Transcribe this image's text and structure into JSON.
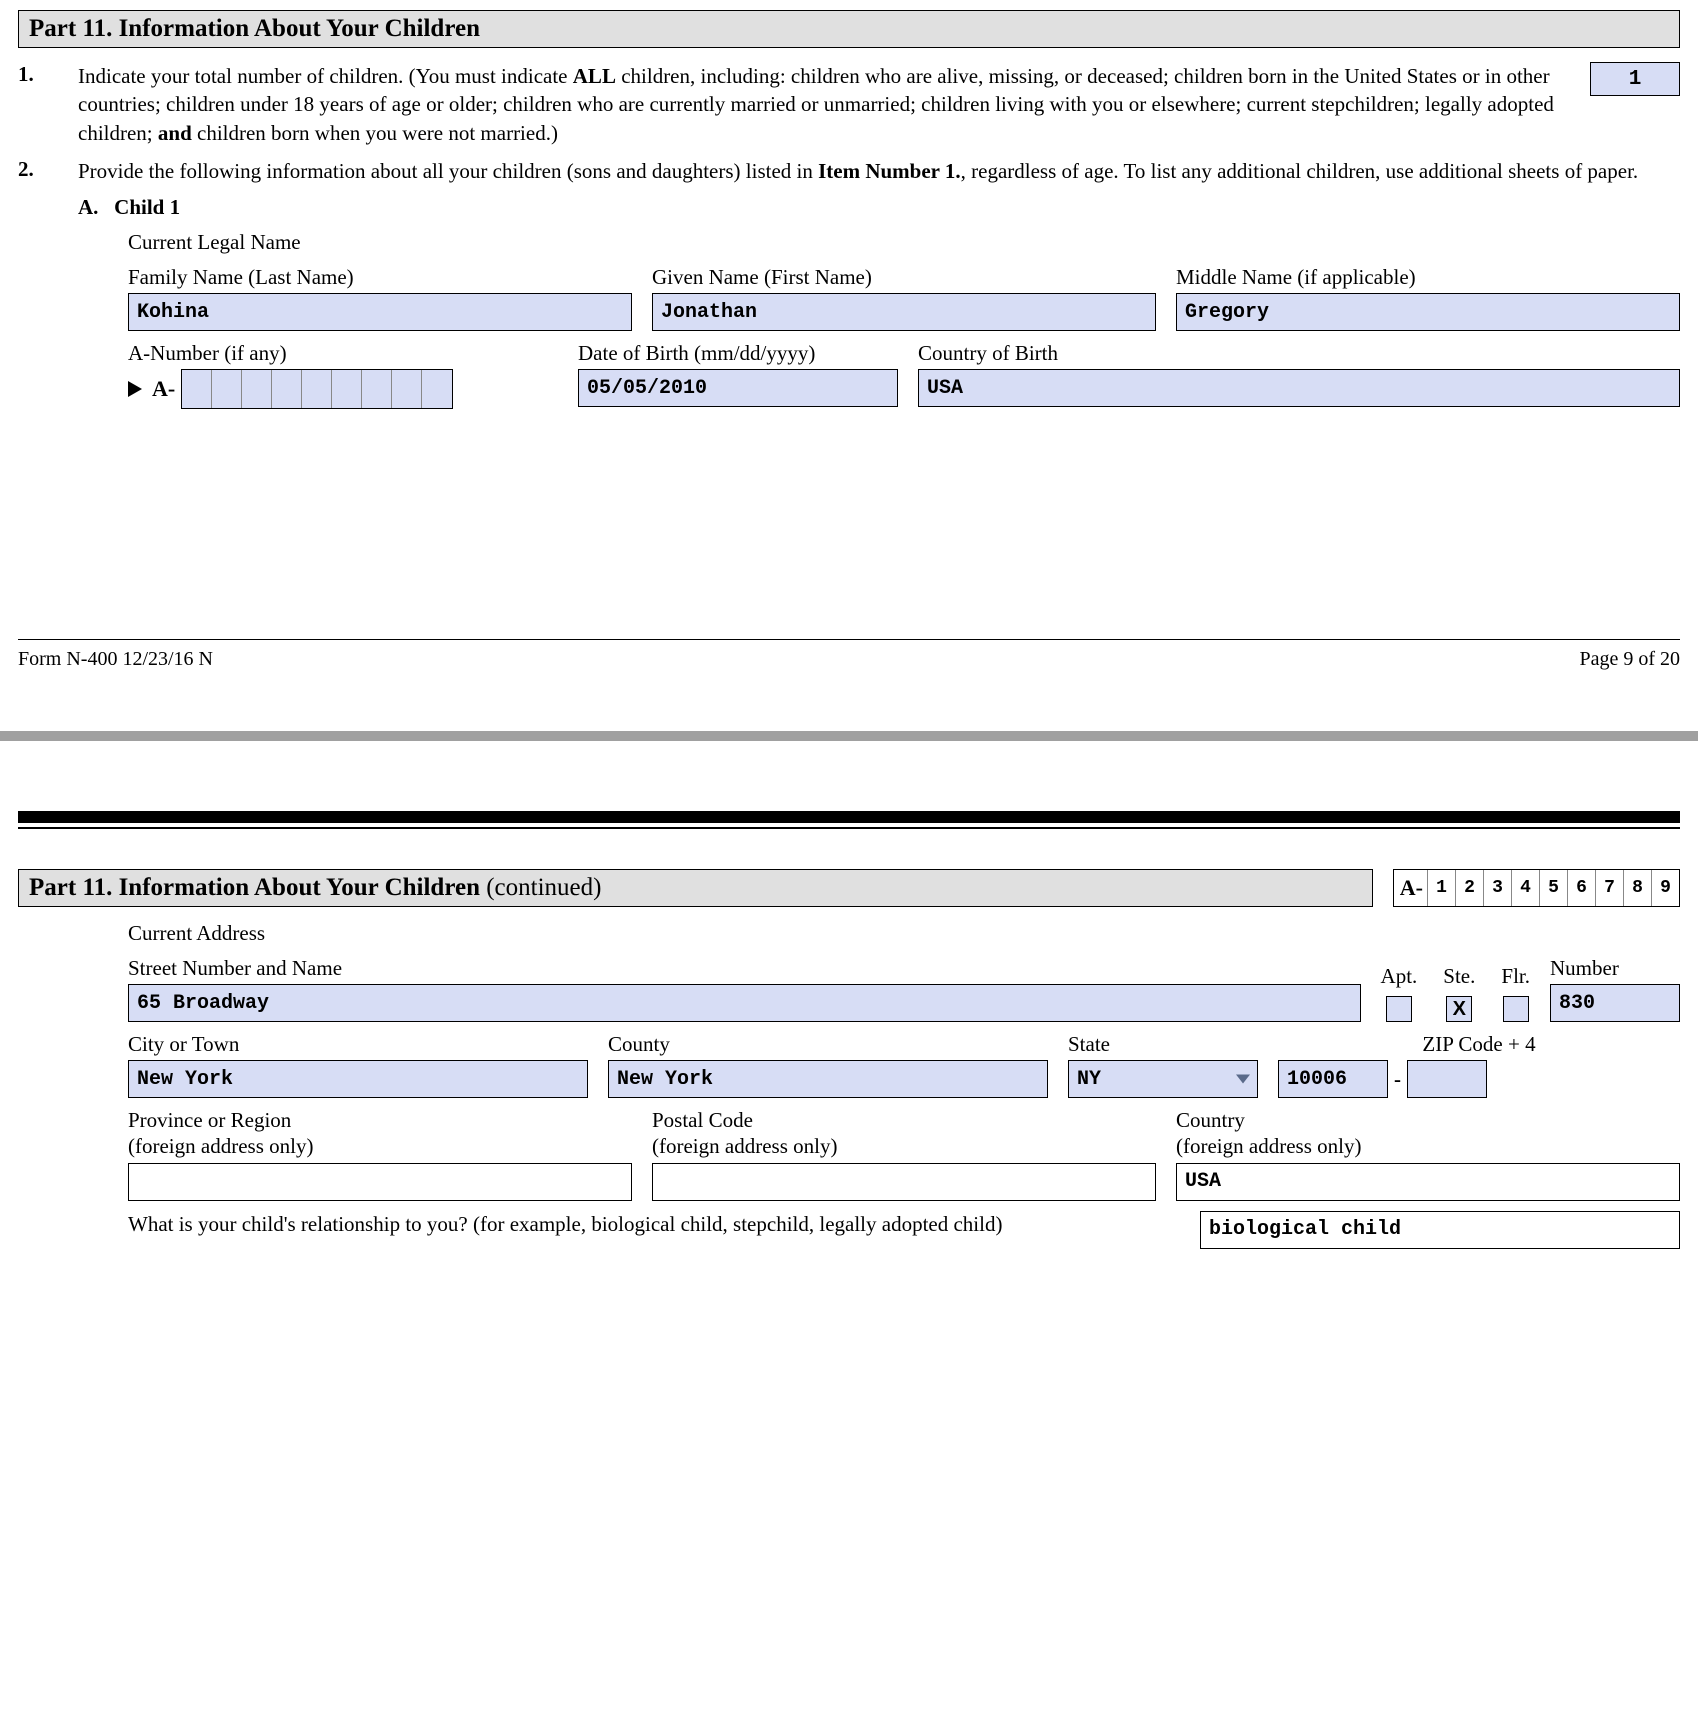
{
  "part": {
    "title_main": "Part 11.  Information About Your Children",
    "title_cont": " (continued)"
  },
  "q1": {
    "num": "1.",
    "text_pre": "Indicate your total number of children.  (You must indicate ",
    "text_all": "ALL",
    "text_mid": " children, including:  children who are alive, missing, or deceased; children born in the United States or in other countries; children under 18 years of age or older; children who are currently married or unmarried; children living with you or elsewhere; current stepchildren; legally adopted children; ",
    "text_and": "and",
    "text_post": " children born when you were not married.)",
    "total": "1"
  },
  "q2": {
    "num": "2.",
    "text_pre": "Provide the following information about all your children (sons and daughters) listed in ",
    "text_bold": "Item Number 1.",
    "text_post": ", regardless of age. To list any additional children, use additional sheets of paper."
  },
  "childA": {
    "letter": "A.",
    "heading": "Child 1",
    "legal_name_label": "Current Legal Name",
    "family_label": "Family Name (Last Name)",
    "family_val": "Kohina",
    "given_label": "Given Name (First Name)",
    "given_val": "Jonathan",
    "middle_label": "Middle Name (if applicable)",
    "middle_val": "Gregory",
    "anum_label": "A-Number (if any)",
    "anum_prefix": "A-",
    "dob_label": "Date of Birth (mm/dd/yyyy)",
    "dob_val": "05/05/2010",
    "cob_label": "Country of Birth",
    "cob_val": "USA"
  },
  "footer": {
    "form": "Form N-400   12/23/16   N",
    "page": "Page 9 of 20"
  },
  "a_header": {
    "prefix": "A-",
    "digits": [
      "1",
      "2",
      "3",
      "4",
      "5",
      "6",
      "7",
      "8",
      "9"
    ]
  },
  "address": {
    "heading": "Current Address",
    "street_label": "Street Number and Name",
    "street_val": "65 Broadway",
    "apt_label": "Apt.",
    "ste_label": "Ste.",
    "flr_label": "Flr.",
    "number_label": "Number",
    "apt_checked": "",
    "ste_checked": "X",
    "flr_checked": "",
    "number_val": "830",
    "city_label": "City or Town",
    "city_val": "New York",
    "county_label": "County",
    "county_val": "New York",
    "state_label": "State",
    "state_val": "NY",
    "zip_label": "ZIP Code + 4",
    "zip_val": "10006",
    "zip4_val": "",
    "province_label1": "Province or Region",
    "province_label2": "(foreign address only)",
    "province_val": "",
    "postal_label1": "Postal Code",
    "postal_label2": "(foreign address only)",
    "postal_val": "",
    "country_label1": "Country",
    "country_label2": "(foreign address only)",
    "country_val": "USA"
  },
  "relationship": {
    "question": "What is your child's relationship to you? (for example, biological child, stepchild, legally adopted child)",
    "value": "biological child"
  }
}
